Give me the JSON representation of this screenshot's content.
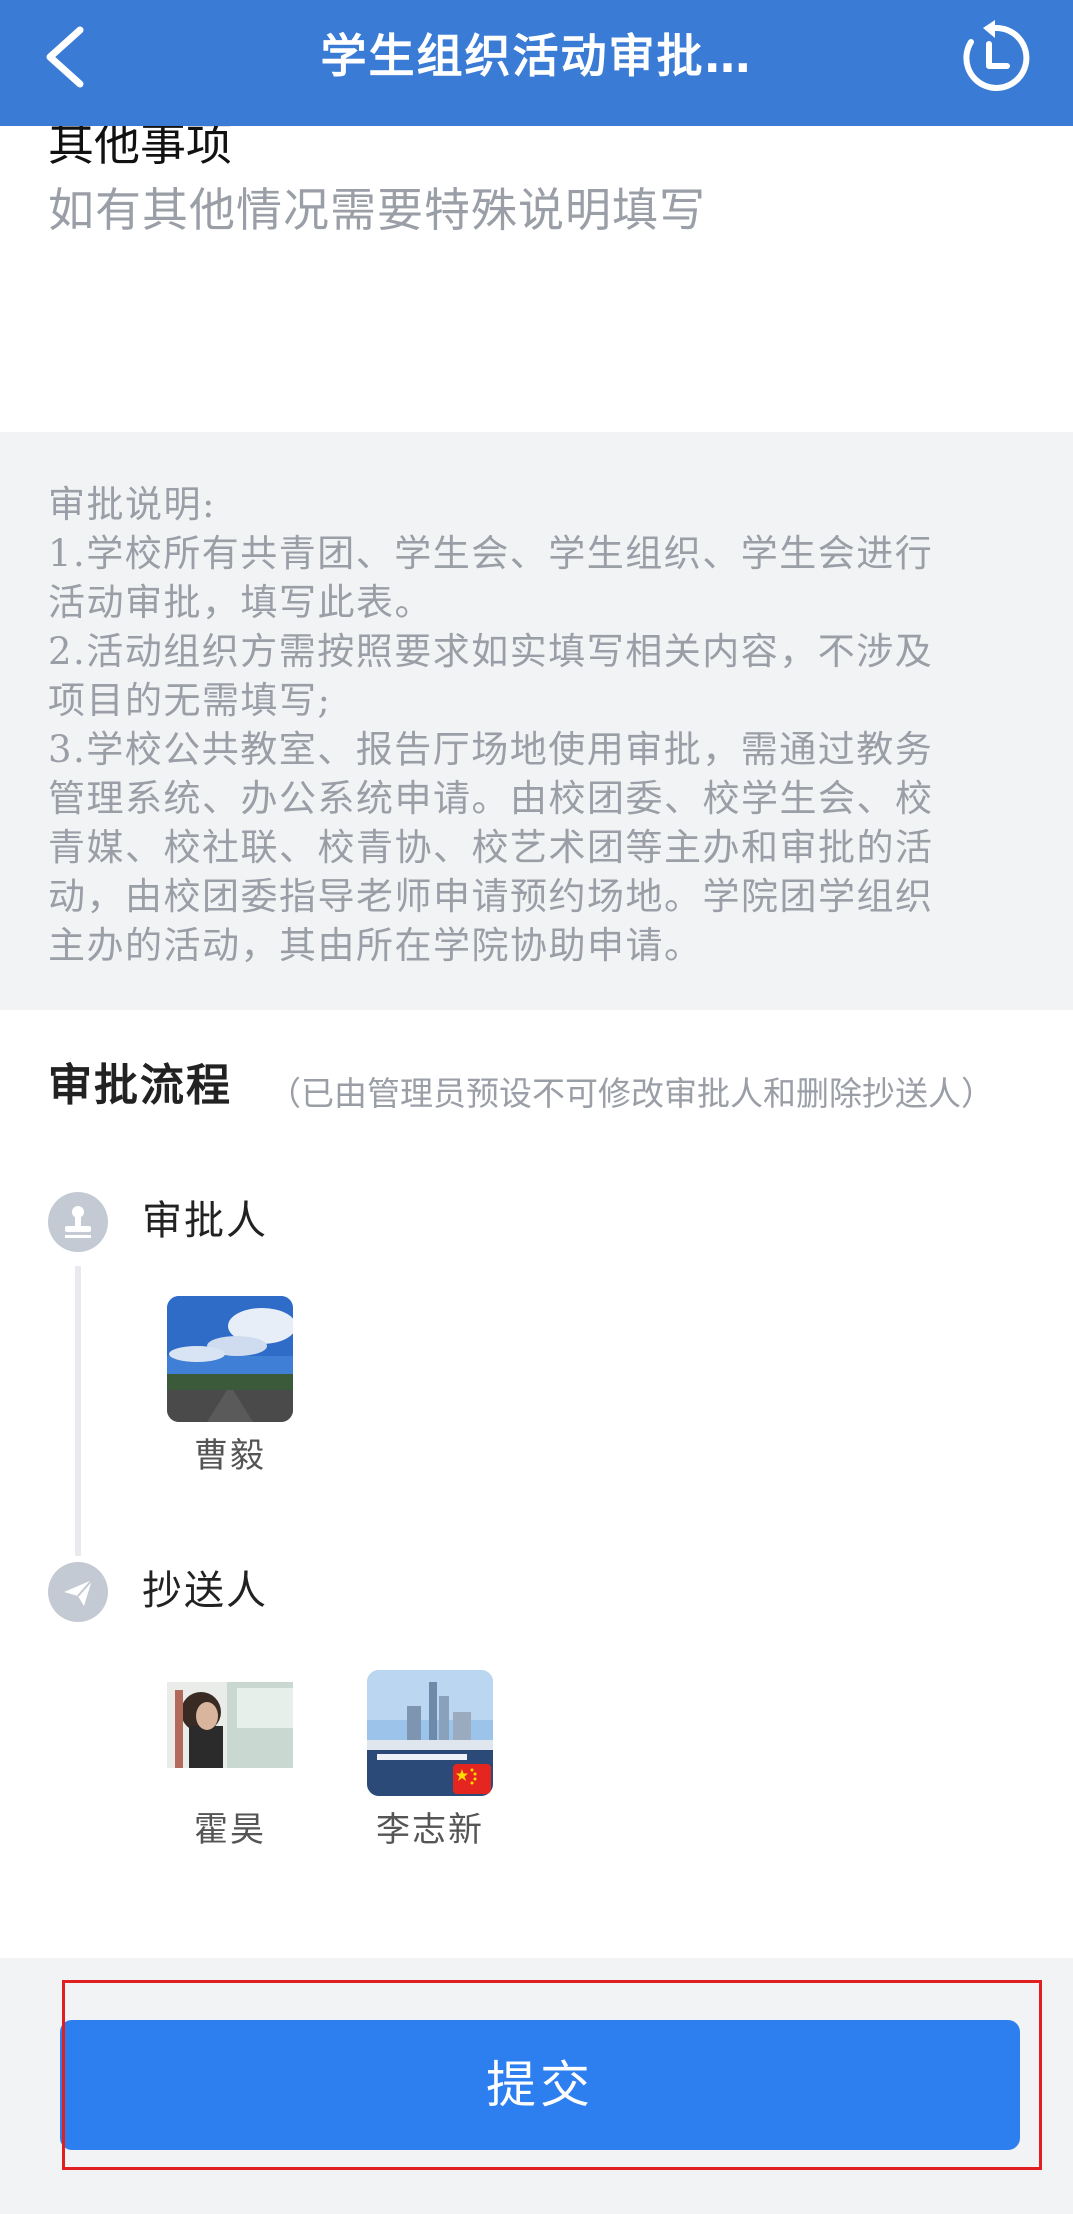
{
  "header": {
    "title": "学生组织活动审批…",
    "back_icon": "chevron-left-icon",
    "history_icon": "history-clock-icon",
    "bg_color": "#3a7bd5"
  },
  "other_matters": {
    "label": "其他事项",
    "placeholder": "如有其他情况需要特殊说明填写"
  },
  "notes": {
    "lines": [
      "审批说明:",
      "1.学校所有共青团、学生会、学生组织、学生会进行",
      "活动审批，填写此表。",
      "2.活动组织方需按照要求如实填写相关内容，不涉及",
      "项目的无需填写;",
      "3.学校公共教室、报告厅场地使用审批，需通过教务",
      "管理系统、办公系统申请。由校团委、校学生会、校",
      "青媒、校社联、校青协、校艺术团等主办和审批的活",
      "动，由校团委指导老师申请预约场地。学院团学组织",
      "主办的活动，其由所在学院协助申请。"
    ]
  },
  "flow": {
    "title": "审批流程",
    "note": "（已由管理员预设不可修改审批人和删除抄送人）",
    "approver": {
      "label": "审批人",
      "icon": "stamp-icon",
      "people": [
        {
          "name": "曹毅"
        }
      ]
    },
    "cc": {
      "label": "抄送人",
      "icon": "paper-plane-icon",
      "people": [
        {
          "name": "霍昊"
        },
        {
          "name": "李志新"
        }
      ]
    }
  },
  "footer": {
    "submit_label": "提交",
    "submit_color": "#2d7ff0",
    "highlight_color": "#e02020"
  }
}
